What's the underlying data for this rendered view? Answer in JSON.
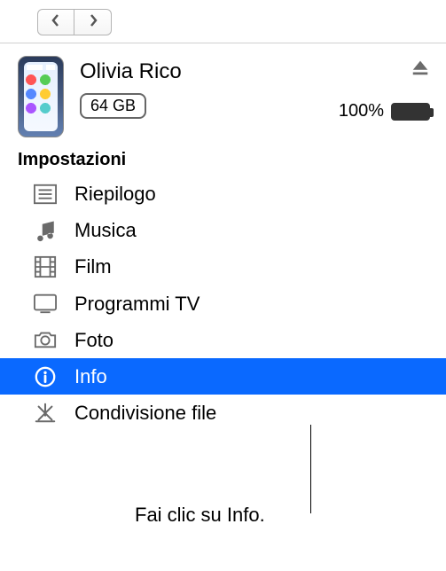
{
  "nav": {
    "back": "back",
    "forward": "forward"
  },
  "device": {
    "name": "Olivia Rico",
    "storage": "64 GB",
    "batteryPercent": "100%"
  },
  "settings": {
    "title": "Impostazioni",
    "items": [
      {
        "label": "Riepilogo",
        "icon": "summary",
        "selected": false
      },
      {
        "label": "Musica",
        "icon": "music",
        "selected": false
      },
      {
        "label": "Film",
        "icon": "film",
        "selected": false
      },
      {
        "label": "Programmi TV",
        "icon": "tv",
        "selected": false
      },
      {
        "label": "Foto",
        "icon": "photos",
        "selected": false
      },
      {
        "label": "Info",
        "icon": "info",
        "selected": true
      },
      {
        "label": "Condivisione file",
        "icon": "apps",
        "selected": false
      }
    ]
  },
  "callout": "Fai clic su Info."
}
